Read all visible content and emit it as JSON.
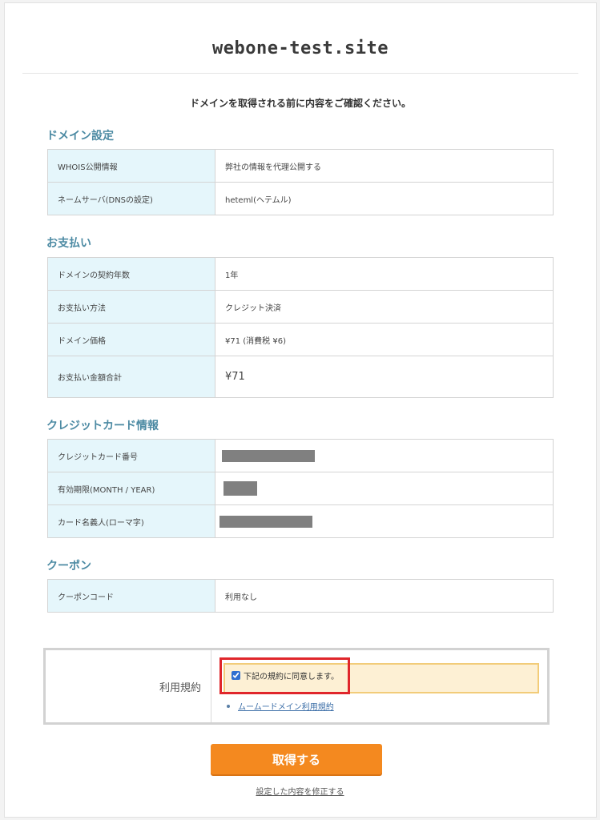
{
  "header": {
    "site_title": "webone-test.site"
  },
  "lead_text": "ドメインを取得される前に内容をご確認ください。",
  "sections": {
    "domain": {
      "heading": "ドメイン設定",
      "rows": [
        {
          "label": "WHOIS公開情報",
          "value": "弊社の情報を代理公開する"
        },
        {
          "label": "ネームサーバ(DNSの設定)",
          "value": "heteml(ヘテムル)"
        }
      ]
    },
    "payment": {
      "heading": "お支払い",
      "rows": [
        {
          "label": "ドメインの契約年数",
          "value": "1年"
        },
        {
          "label": "お支払い方法",
          "value": "クレジット決済"
        },
        {
          "label": "ドメイン価格",
          "value": "¥71 (消費税 ¥6)"
        },
        {
          "label": "お支払い金額合計",
          "value": "¥71"
        }
      ]
    },
    "credit_card": {
      "heading": "クレジットカード情報",
      "rows": [
        {
          "label": "クレジットカード番号"
        },
        {
          "label": "有効期限(MONTH / YEAR)"
        },
        {
          "label": "カード名義人(ローマ字)"
        }
      ]
    },
    "coupon": {
      "heading": "クーポン",
      "rows": [
        {
          "label": "クーポンコード",
          "value": "利用なし"
        }
      ]
    }
  },
  "terms": {
    "label": "利用規約",
    "agree_text": "下記の規約に同意します。",
    "agree_checked": true,
    "link_text": "ムームードメイン利用規約"
  },
  "actions": {
    "submit_label": "取得する",
    "edit_link": "設定した内容を修正する"
  },
  "colors": {
    "accent_orange": "#f4891f",
    "section_heading": "#4c8aa3",
    "key_cell_bg": "#e5f6fb",
    "highlight_red": "#e0262b"
  }
}
